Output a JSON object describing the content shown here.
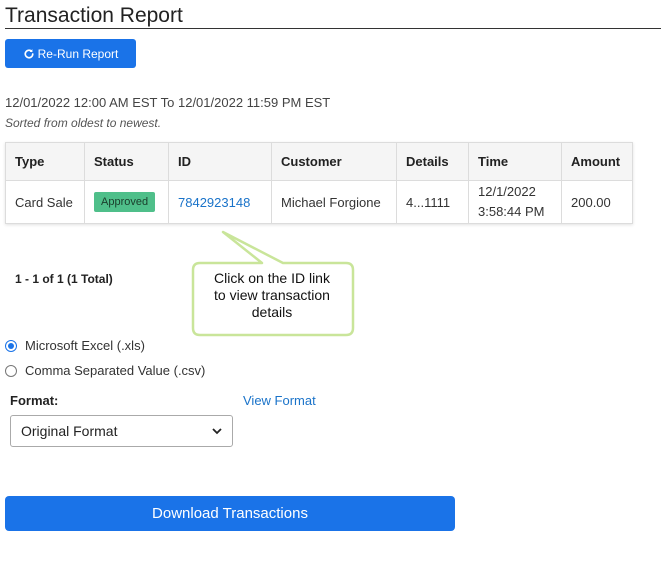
{
  "page": {
    "title": "Transaction Report",
    "rerun_label": "Re-Run Report",
    "date_range": "12/01/2022 12:00 AM EST To 12/01/2022 11:59 PM EST",
    "sort_note": "Sorted from oldest to newest."
  },
  "table": {
    "headers": [
      "Type",
      "Status",
      "ID",
      "Customer",
      "Details",
      "Time",
      "Amount"
    ],
    "rows": [
      {
        "type": "Card Sale",
        "status": "Approved",
        "id": "7842923148",
        "customer": "Michael Forgione",
        "details": "4...1111",
        "time_date": "12/1/2022",
        "time_clock": "3:58:44 PM",
        "amount": "200.00"
      }
    ]
  },
  "pagination": {
    "summary": "1 - 1 of 1 (1 Total)"
  },
  "callout": {
    "line1": "Click on the ID link",
    "line2": "to view transaction",
    "line3": "details"
  },
  "export": {
    "options": [
      "Microsoft Excel (.xls)",
      "Comma Separated Value (.csv)"
    ],
    "selected_option": "Microsoft Excel (.xls)",
    "format_label": "Format:",
    "view_format_label": "View Format",
    "format_value": "Original Format",
    "download_label": "Download Transactions"
  },
  "colors": {
    "primary": "#1a73e8",
    "approved_badge": "#4fbf8a",
    "link": "#1a73c9",
    "callout_border": "#c9e59a"
  }
}
